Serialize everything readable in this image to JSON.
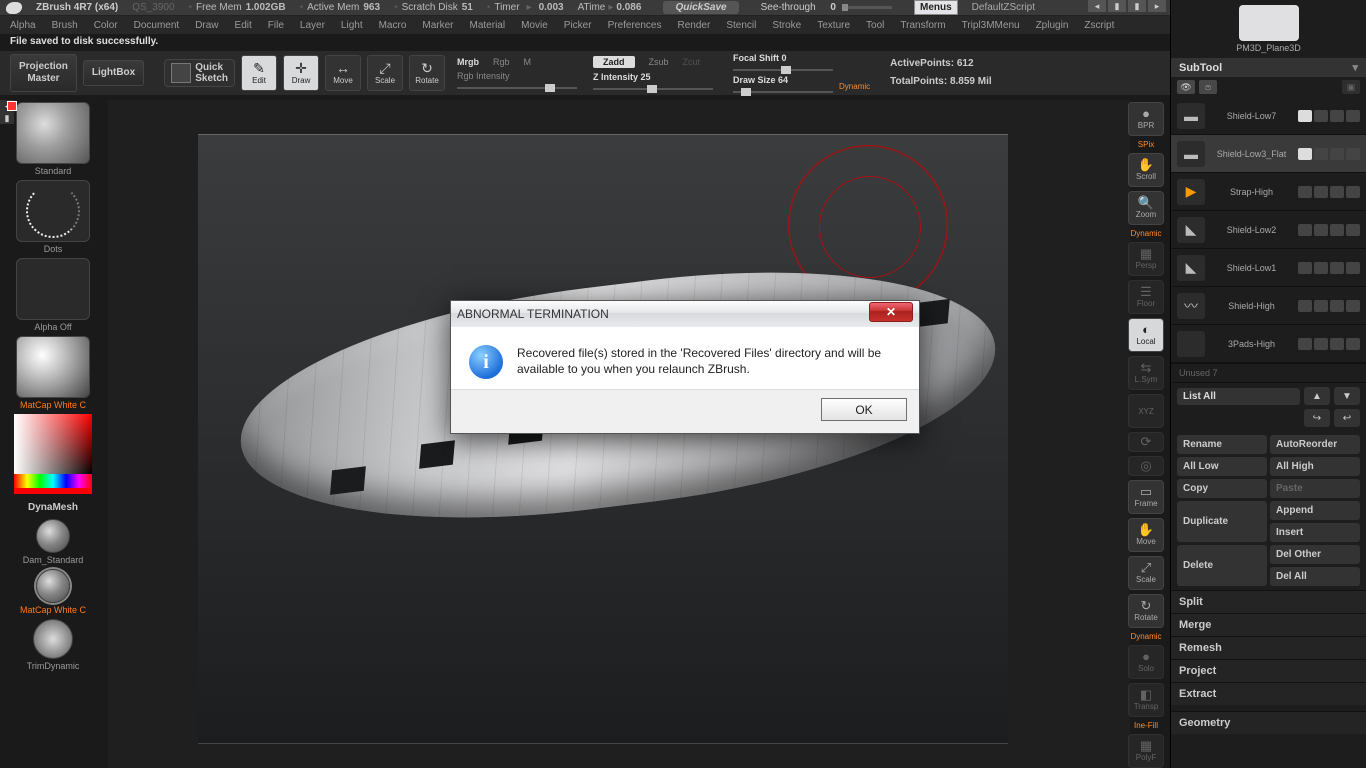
{
  "topbar": {
    "app": "ZBrush 4R7 (x64)",
    "project": "QS_3900",
    "free_mem_label": "Free Mem",
    "free_mem": "1.002GB",
    "active_mem_label": "Active Mem",
    "active_mem": "963",
    "scratch_label": "Scratch Disk",
    "scratch": "51",
    "timer_label": "Timer",
    "timer": "0.003",
    "atime_label": "ATime",
    "atime": "0.086",
    "quicksave": "QuickSave",
    "see_through_label": "See-through",
    "see_through_val": "0",
    "menus": "Menus",
    "default_script": "DefaultZScript"
  },
  "menubar": [
    "Alpha",
    "Brush",
    "Color",
    "Document",
    "Draw",
    "Edit",
    "File",
    "Layer",
    "Light",
    "Macro",
    "Marker",
    "Material",
    "Movie",
    "Picker",
    "Preferences",
    "Render",
    "Stencil",
    "Stroke",
    "Texture",
    "Tool",
    "Transform",
    "Tripl3MMenu",
    "Zplugin",
    "Zscript"
  ],
  "status": "File saved to disk successfully.",
  "toolbar": {
    "projection_master": "Projection\nMaster",
    "lightbox": "LightBox",
    "quick_sketch": "Quick\nSketch",
    "edit": "Edit",
    "draw": "Draw",
    "move": "Move",
    "scale": "Scale",
    "rotate": "Rotate",
    "mrgb": "Mrgb",
    "rgb": "Rgb",
    "m": "M",
    "rgb_intensity": "Rgb Intensity",
    "zadd": "Zadd",
    "zsub": "Zsub",
    "zcut": "Zcut",
    "z_intensity": "Z Intensity 25",
    "focal_shift": "Focal Shift 0",
    "draw_size": "Draw Size 64",
    "dynamic_label": "Dynamic",
    "active_points": "ActivePoints: 612",
    "total_points": "TotalPoints: 8.859 Mil"
  },
  "left": {
    "standard": "Standard",
    "dots": "Dots",
    "alpha_off": "Alpha Off",
    "matcap1": "MatCap White C",
    "dynamesh": "DynaMesh",
    "dam_std": "Dam_Standard",
    "matcap2": "MatCap White C",
    "trim": "TrimDynamic"
  },
  "rcol": {
    "bpr": "BPR",
    "spix": "SPix",
    "scroll": "Scroll",
    "zoom": "Zoom",
    "persp": "Persp",
    "floor": "Floor",
    "local": "Local",
    "lsym": "L.Sym",
    "xyz": "XYZ",
    "frame": "Frame",
    "move": "Move",
    "scale": "Scale",
    "rotate": "Rotate",
    "solo": "Solo",
    "transp": "Transp",
    "polyf": "PolyF",
    "dynamic": "Dynamic",
    "inefill": "Ine-Fill"
  },
  "right": {
    "tool_name": "PM3D_Plane3D",
    "subtool_header": "SubTool",
    "subtools": [
      {
        "name": "Shield-Low7"
      },
      {
        "name": "Shield-Low3_Flat"
      },
      {
        "name": "Strap-High"
      },
      {
        "name": "Shield-Low2"
      },
      {
        "name": "Shield-Low1"
      },
      {
        "name": "Shield-High"
      },
      {
        "name": "3Pads-High"
      }
    ],
    "unused": "Unused 7",
    "list_all": "List All",
    "buttons": {
      "rename": "Rename",
      "autoreorder": "AutoReorder",
      "all_low": "All Low",
      "all_high": "All High",
      "copy": "Copy",
      "paste": "Paste",
      "duplicate": "Duplicate",
      "append": "Append",
      "insert": "Insert",
      "delete": "Delete",
      "del_other": "Del Other",
      "del_all": "Del All"
    },
    "sections": [
      "Split",
      "Merge",
      "Remesh",
      "Project",
      "Extract",
      "Geometry"
    ]
  },
  "dialog": {
    "title": "ABNORMAL TERMINATION",
    "message": "Recovered file(s) stored in the 'Recovered Files' directory and will be available to you when you relaunch ZBrush.",
    "ok": "OK"
  }
}
